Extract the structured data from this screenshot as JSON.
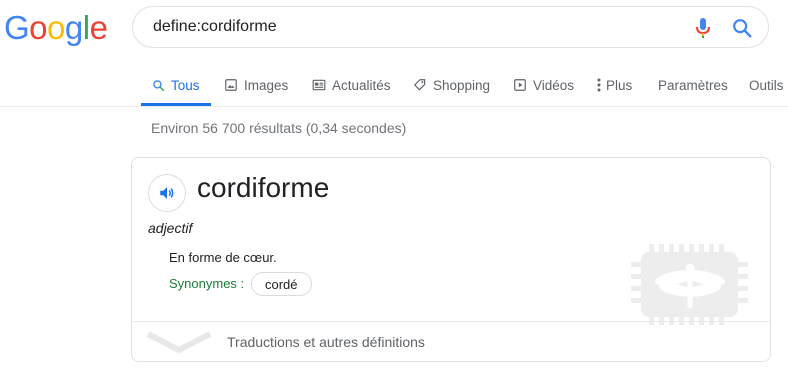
{
  "logo": {
    "letters": [
      "G",
      "o",
      "o",
      "g",
      "l",
      "e"
    ],
    "colors": [
      "#4285F4",
      "#EA4335",
      "#FBBC05",
      "#4285F4",
      "#34A853",
      "#EA4335"
    ]
  },
  "search": {
    "query": "define:cordiforme",
    "mic_icon": "mic-icon",
    "search_icon": "search-icon"
  },
  "tabs": [
    {
      "label": "Tous",
      "icon": "search-icon",
      "active": true
    },
    {
      "label": "Images",
      "icon": "image-icon"
    },
    {
      "label": "Actualités",
      "icon": "news-icon"
    },
    {
      "label": "Shopping",
      "icon": "tag-icon"
    },
    {
      "label": "Vidéos",
      "icon": "play-icon"
    },
    {
      "label": "Plus",
      "icon": "more-vert-icon"
    },
    {
      "label": "Paramètres"
    },
    {
      "label": "Outils"
    }
  ],
  "stats": "Environ 56 700 résultats (0,34 secondes)",
  "dictionary": {
    "word": "cordiforme",
    "part_of_speech": "adjectif",
    "definition": "En forme de cœur.",
    "synonyms_label": "Synonymes :",
    "synonyms": [
      "cordé"
    ],
    "more_label": "Traductions et autres définitions"
  },
  "colors": {
    "accent": "#1a73e8",
    "synonym_green": "#188038",
    "text": "#202124",
    "muted": "#70757a"
  }
}
